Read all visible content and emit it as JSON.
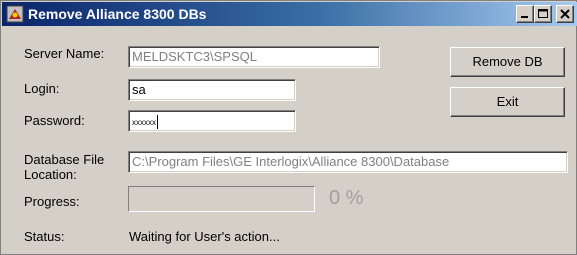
{
  "window": {
    "title": "Remove Alliance 8300 DBs"
  },
  "form": {
    "server_name_label": "Server Name:",
    "server_name_value": "MELDSKTC3\\SPSQL",
    "login_label": "Login:",
    "login_value": "sa",
    "password_label": "Password:",
    "password_value": "xxxxxx",
    "db_location_label_1": "Database File",
    "db_location_label_2": "Location:",
    "db_location_value": "C:\\Program Files\\GE Interlogix\\Alliance 8300\\Database",
    "progress_label": "Progress:",
    "progress_fraction": 0,
    "progress_text": "0 %",
    "status_label": "Status:",
    "status_value": "Waiting for User's action..."
  },
  "buttons": {
    "remove_db_label": "Remove DB",
    "exit_label": "Exit"
  },
  "icons": {
    "window_icon": "app-icon",
    "minimize": "minimize-icon",
    "maximize": "maximize-icon",
    "close": "close-icon"
  }
}
